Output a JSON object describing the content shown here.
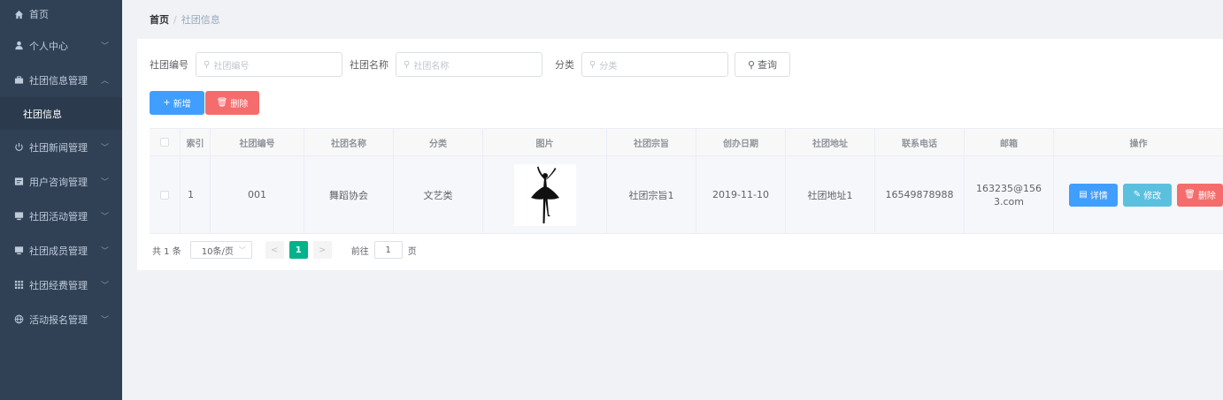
{
  "sidebar": {
    "items": [
      {
        "label": "首页",
        "icon": "home-icon",
        "chevron": false
      },
      {
        "label": "个人中心",
        "icon": "user-icon",
        "chevron": true
      },
      {
        "label": "社团信息管理",
        "icon": "briefcase-icon",
        "chevron": true,
        "expanded": true
      },
      {
        "label": "社团新闻管理",
        "icon": "power-icon",
        "chevron": true
      },
      {
        "label": "用户咨询管理",
        "icon": "message-icon",
        "chevron": true
      },
      {
        "label": "社团活动管理",
        "icon": "monitor-icon",
        "chevron": true
      },
      {
        "label": "社团成员管理",
        "icon": "monitor-icon",
        "chevron": true
      },
      {
        "label": "社团经费管理",
        "icon": "grid-icon",
        "chevron": true
      },
      {
        "label": "活动报名管理",
        "icon": "globe-icon",
        "chevron": true
      }
    ],
    "sub_item": "社团信息"
  },
  "breadcrumb": {
    "home": "首页",
    "separator": "/",
    "current": "社团信息"
  },
  "search": {
    "fields": [
      {
        "label": "社团编号",
        "placeholder": "社团编号"
      },
      {
        "label": "社团名称",
        "placeholder": "社团名称"
      },
      {
        "label": "分类",
        "placeholder": "分类"
      }
    ],
    "query_label": "查询"
  },
  "toolbar": {
    "add_label": "新增",
    "delete_label": "删除"
  },
  "table": {
    "headers": [
      "索引",
      "社团编号",
      "社团名称",
      "分类",
      "图片",
      "社团宗旨",
      "创办日期",
      "社团地址",
      "联系电话",
      "邮箱",
      "操作"
    ],
    "rows": [
      {
        "index": "1",
        "code": "001",
        "name": "舞蹈协会",
        "category": "文艺类",
        "purpose": "社团宗旨1",
        "founded": "2019-11-10",
        "address": "社团地址1",
        "phone": "16549878988",
        "email": "163235@1563.com",
        "actions": {
          "detail": "详情",
          "edit": "修改",
          "delete": "删除"
        }
      }
    ]
  },
  "pagination": {
    "total": "共 1 条",
    "page_size": "10条/页",
    "current": "1",
    "goto_prefix": "前往",
    "goto_value": "1",
    "goto_suffix": "页"
  },
  "colors": {
    "sidebar_bg": "#304156",
    "primary": "#409eff",
    "danger": "#f56c6c",
    "info": "#5bc0de",
    "page_active": "#00b38a"
  }
}
